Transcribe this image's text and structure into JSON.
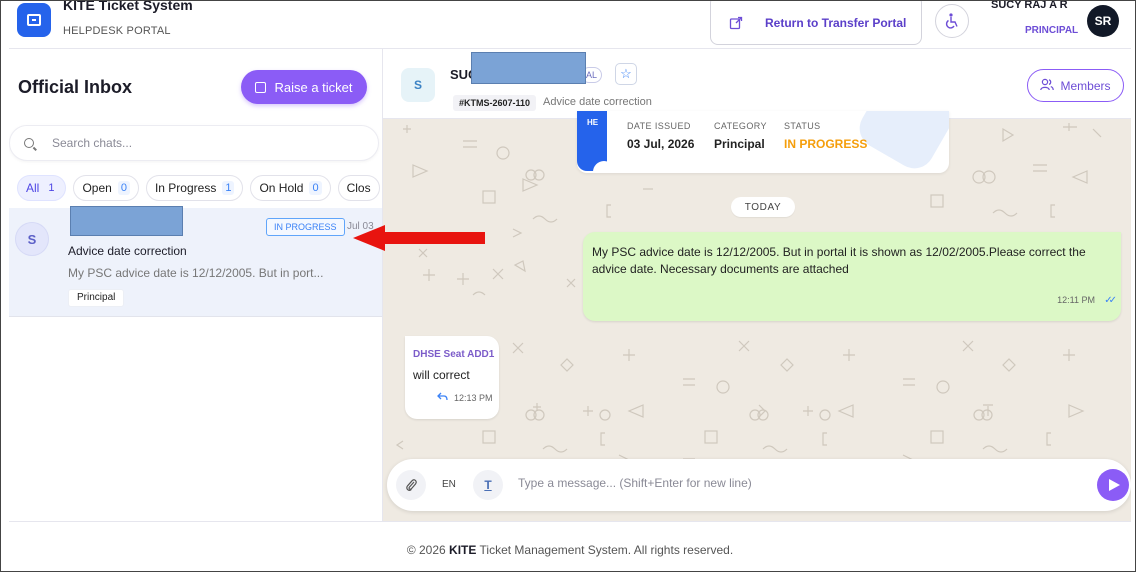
{
  "app": {
    "title": "KITE Ticket System",
    "subtitle": "HELPDESK PORTAL"
  },
  "header": {
    "return_label": "Return to Transfer Portal",
    "user_name": "SUCY RAJ A R",
    "user_role": "PRINCIPAL",
    "user_initials": "SR"
  },
  "inbox": {
    "title": "Official Inbox",
    "raise_label": "Raise a ticket",
    "search_placeholder": "Search chats...",
    "filters": [
      {
        "label": "All",
        "count": "1"
      },
      {
        "label": "Open",
        "count": "0"
      },
      {
        "label": "In Progress",
        "count": "1"
      },
      {
        "label": "On Hold",
        "count": "0"
      },
      {
        "label": "Clos",
        "count": ""
      }
    ],
    "tickets": [
      {
        "avatar": "S",
        "status": "IN PROGRESS",
        "date": "Jul 03",
        "subject": "Advice date correction",
        "preview": "My PSC advice date is 12/12/2005. But in port...",
        "category": "Principal"
      }
    ]
  },
  "chat": {
    "avatar": "S",
    "name_prefix": "SUC",
    "name_tag_suffix": "AL",
    "ticket_id": "#KTMS-2607-110",
    "subject": "Advice date correction",
    "members_label": "Members",
    "info_card": {
      "stripe_text": "HE",
      "date_label": "DATE ISSUED",
      "date_value": "03 Jul, 2026",
      "category_label": "CATEGORY",
      "category_value": "Principal",
      "status_label": "STATUS",
      "status_value": "IN PROGRESS",
      "status_color": "#f59e0b"
    },
    "date_divider": "TODAY",
    "messages": [
      {
        "direction": "out",
        "text": "My PSC advice date is 12/12/2005. But in portal it is shown as 12/02/2005.Please correct the advice date. Necessary documents are attached",
        "time": "12:11 PM"
      },
      {
        "direction": "in",
        "sender": "DHSE Seat ADD1",
        "text": "will correct",
        "time": "12:13 PM"
      }
    ],
    "composer": {
      "lang": "EN",
      "placeholder": "Type a message... (Shift+Enter for new line)"
    }
  },
  "footer": {
    "prefix": "© 2026",
    "brand": "KITE",
    "suffix": "Ticket Management System. All rights reserved."
  },
  "colors": {
    "accent": "#8b5cf6",
    "brand_blue": "#2563eb",
    "chat_bg": "#efeae2",
    "outgoing_bubble": "#dcf8c6",
    "annotation_arrow": "#e8140f"
  },
  "icons": {
    "logo": "ticket-icon",
    "return": "external-link-icon",
    "accessibility": "accessibility-icon",
    "raise": "edit-square-icon",
    "search": "search-icon",
    "star": "star-icon",
    "members": "users-icon",
    "attach": "paperclip-icon",
    "format": "text-format-icon",
    "send": "send-icon",
    "read": "double-check-icon",
    "reply": "reply-icon"
  }
}
